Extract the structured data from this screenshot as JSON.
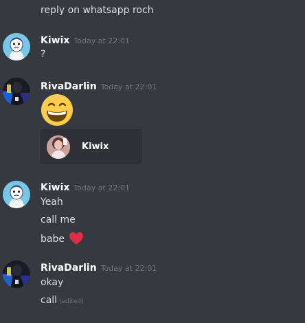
{
  "messages": [
    {
      "text": "reply on whatsapp roch"
    },
    {
      "author": "Kiwix",
      "time": "Today at 22:01",
      "lines": [
        "?"
      ]
    },
    {
      "author": "RivaDarlin",
      "time": "Today at 22:01",
      "emoji": "grinning-face-with-smiling-eyes",
      "embed": {
        "name": "Kiwix"
      }
    },
    {
      "author": "Kiwix",
      "time": "Today at 22:01",
      "lines": [
        "Yeah",
        "call me",
        "babe"
      ],
      "heart": "red-heart"
    },
    {
      "author": "RivaDarlin",
      "time": "Today at 22:01",
      "lines": [
        "okay",
        "call"
      ],
      "edited": "(edited)"
    }
  ],
  "colors": {
    "background": "#36393f",
    "text": "#dcddde",
    "username": "#ffffff",
    "timestamp": "#72767d",
    "embed_bg": "#2f3136"
  }
}
